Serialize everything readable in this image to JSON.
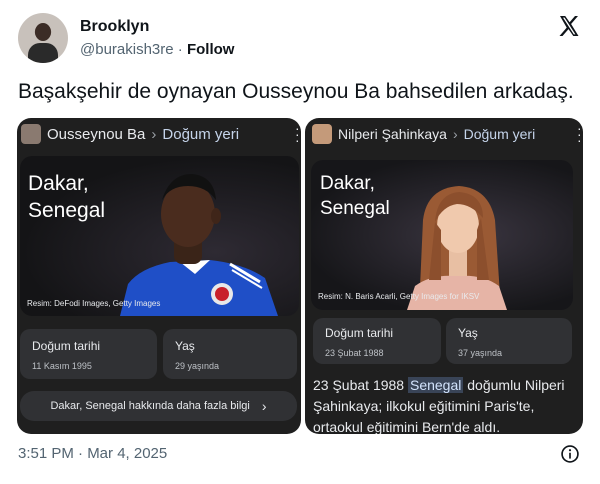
{
  "tweet": {
    "user_name": "Brooklyn",
    "handle": "@burakish3re",
    "separator": "·",
    "follow_label": "Follow",
    "text": "Başakşehir de oynayan Ousseynou Ba bahsedilen arkadaş.",
    "timestamp": "3:51 PM · Mar 4, 2025"
  },
  "icons": {
    "brand": "x-logo-icon",
    "info": "info-icon",
    "more": "kebab-menu-icon",
    "chevron": "chevron-right-icon"
  },
  "left_panel": {
    "entity": "Ousseynou Ba",
    "separator": "›",
    "attribute": "Doğum yeri",
    "hero_line1": "Dakar,",
    "hero_line2": "Senegal",
    "credit": "Resim: DeFodi Images, Getty Images",
    "fact1_label": "Doğum tarihi",
    "fact1_value": "11 Kasım 1995",
    "fact2_label": "Yaş",
    "fact2_value": "29 yaşında",
    "more_label": "Dakar, Senegal hakkında daha fazla bilgi",
    "more_chevron": "›"
  },
  "right_panel": {
    "entity": "Nilperi Şahinkaya",
    "separator": "›",
    "attribute": "Doğum yeri",
    "hero_line1": "Dakar,",
    "hero_line2": "Senegal",
    "credit": "Resim: N. Baris Acarli, Getty Images for IKSV",
    "fact1_label": "Doğum tarihi",
    "fact1_value": "23 Şubat 1988",
    "fact2_label": "Yaş",
    "fact2_value": "37 yaşında",
    "desc_before": "23 Şubat 1988 ",
    "desc_highlight": "Senegal",
    "desc_after": " doğumlu Nilperi Şahinkaya; ilkokul eğitimini Paris'te, ortaokul eğitimini Bern'de aldı."
  },
  "colors": {
    "panel_bg": "#1f1f1f",
    "chip_bg": "#303134",
    "highlight_bg": "#394457",
    "shirt_blue": "#1f4fc7"
  }
}
